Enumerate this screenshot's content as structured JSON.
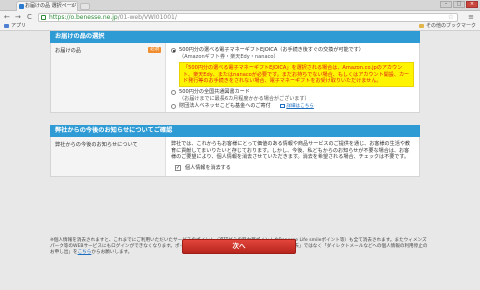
{
  "browser": {
    "tab_title": "お届けの品 選択ページ",
    "tab_close": "×",
    "url_host": "https://o.benesse.ne.jp",
    "url_path": "/01-web/VWI01001/",
    "star": "☆",
    "menu": "≡",
    "nav_back": "←",
    "nav_forward": "→",
    "nav_reload": "C",
    "win_min": "–",
    "win_max": "□",
    "win_close": "×"
  },
  "bookmarks": {
    "apps": "アプリ",
    "other": "その他のブックマーク"
  },
  "gift_section": {
    "header": "お届けの品の選択",
    "label": "お届けの品",
    "required": "必須",
    "option1_title": "500円分の選べる電子マネーギフトEJOICA（お手続き後すぐの交換が可能です）",
    "option1_sub": "（Amazonギフト券・楽天Edy・nanaco）",
    "notice": "「500円分の選べる電子マネーギフトEJOICA」を選択される場合は、Amazon.co.jpのアカウント、楽天Edy、またはnanacoが必要です。まだお持ちでない場合、もしくはアカウント開設、カード発行等のお手続きをされない場合、電子マネーギフトをお受け取りいただけません。",
    "option2_title": "500円分の全国共通図書カード",
    "option2_sub": "（お届けまでに最長6カ月程度かかる場合がございます）",
    "option3_title": "財団法人ベネッセこども基金へのご寄付",
    "option3_link": "詳細はこちら"
  },
  "info_section": {
    "header": "弊社からの今後のお知らせについてご確認",
    "label": "弊社からの今後のお知らせについて",
    "body": "弊社では、これからもお客様にとって価値のある情報や商品サービスのご提供を通じ、お客様の生活や教育に貢献してまいりたいと存じております。しかし、今後、私どもからのお知らせが不要な場合は、お客様のご要望により、個人情報を消去させていただきます。消去を希望される場合、チェックは不要です。",
    "checkbox_label": "個人情報を消去する",
    "checkbox_checked": true,
    "checkbox_mark": "✓"
  },
  "footnote": {
    "text": "※個人情報を消去されますと、これまでにご利用いただいたサービスのポイント（進研ゼミの努力賞ポイントやBenesse Life smileポイント等）も全て消去されます。またウィメンズパーク等のWEBサービスにもログインができなくなります。ポイント等を引き続きご利用いただく場合は、情報の「消去」ではなく「ダイレクトメールなどへの個人情報の利用停止のお申し出」を",
    "link": "こちら",
    "tail": "からお願いします。"
  },
  "next_button": "次へ"
}
